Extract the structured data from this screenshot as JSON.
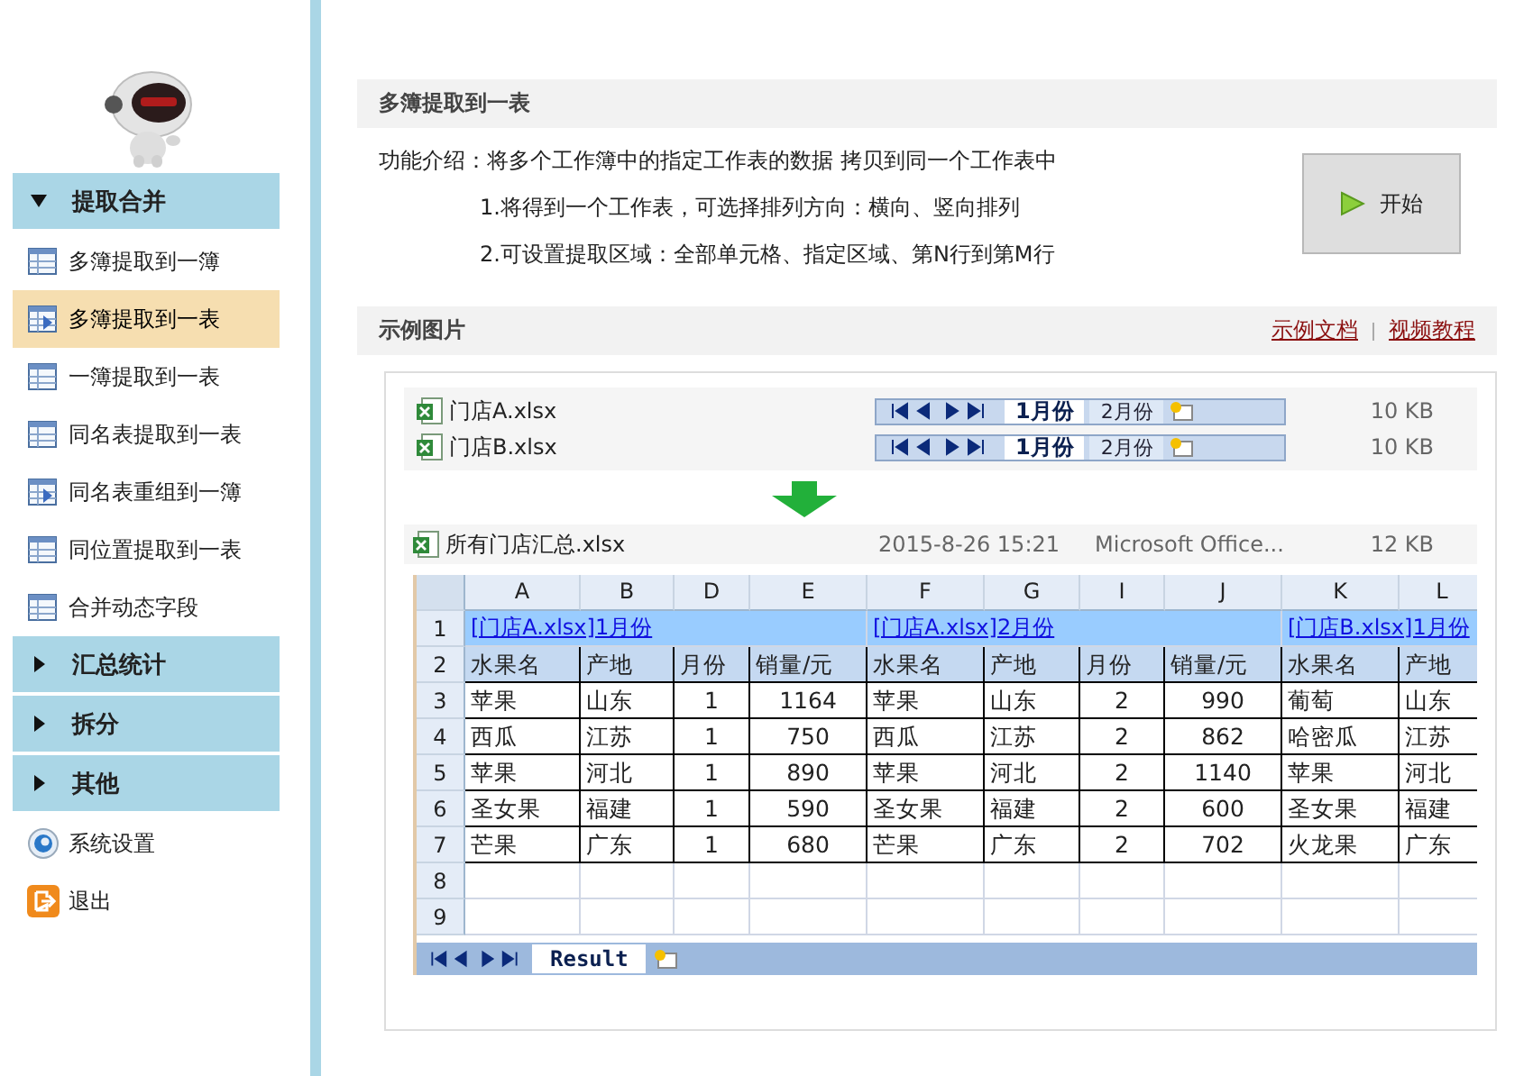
{
  "sidebar": {
    "sections": [
      {
        "title": "提取合并",
        "expanded": true,
        "items": [
          {
            "label": "多簿提取到一簿",
            "selected": false
          },
          {
            "label": "多簿提取到一表",
            "selected": true
          },
          {
            "label": "一簿提取到一表",
            "selected": false
          },
          {
            "label": "同名表提取到一表",
            "selected": false
          },
          {
            "label": "同名表重组到一簿",
            "selected": false
          },
          {
            "label": "同位置提取到一表",
            "selected": false
          },
          {
            "label": "合并动态字段",
            "selected": false
          }
        ]
      },
      {
        "title": "汇总统计",
        "expanded": false
      },
      {
        "title": "拆分",
        "expanded": false
      },
      {
        "title": "其他",
        "expanded": false
      }
    ],
    "footer_items": [
      {
        "label": "系统设置",
        "kind": "settings"
      },
      {
        "label": "退出",
        "kind": "exit"
      }
    ]
  },
  "main": {
    "title": "多簿提取到一表",
    "description": "功能介绍：将多个工作簿中的指定工作表的数据 拷贝到同一个工作表中",
    "points": [
      "1.将得到一个工作表，可选择排列方向：横向、竖向排列",
      "2.可设置提取区域：全部单元格、指定区域、第N行到第M行"
    ],
    "start_button": "开始",
    "example_title": "示例图片",
    "links": [
      "示例文档",
      "视频教程"
    ]
  },
  "example": {
    "source_files": [
      {
        "name": "门店A.xlsx",
        "tabs": [
          {
            "label": "1月份",
            "selected": true
          },
          {
            "label": "2月份",
            "selected": false
          }
        ],
        "size": "10 KB"
      },
      {
        "name": "门店B.xlsx",
        "tabs": [
          {
            "label": "1月份",
            "selected": true
          },
          {
            "label": "2月份",
            "selected": false
          }
        ],
        "size": "10 KB"
      }
    ],
    "result_file": {
      "name": "所有门店汇总.xlsx",
      "date": "2015-8-26 15:21",
      "type": "Microsoft Office...",
      "size": "12 KB"
    },
    "sheet": {
      "columns": [
        {
          "letter": "A",
          "kind": "text"
        },
        {
          "letter": "B",
          "kind": "text"
        },
        {
          "letter": "D",
          "kind": "number"
        },
        {
          "letter": "E",
          "kind": "number"
        },
        {
          "letter": "F",
          "kind": "text"
        },
        {
          "letter": "G",
          "kind": "text"
        },
        {
          "letter": "I",
          "kind": "number"
        },
        {
          "letter": "J",
          "kind": "number"
        },
        {
          "letter": "K",
          "kind": "text"
        },
        {
          "letter": "L",
          "kind": "text"
        }
      ],
      "rows": [
        {
          "number": "1",
          "kind": "title",
          "cells": [
            {
              "text": "[门店A.xlsx]1月份"
            },
            {
              "text": ""
            },
            {
              "text": ""
            },
            {
              "text": ""
            },
            {
              "text": "[门店A.xlsx]2月份"
            },
            {
              "text": ""
            },
            {
              "text": ""
            },
            {
              "text": ""
            },
            {
              "text": "[门店B.xlsx]1月份"
            },
            {
              "text": ""
            }
          ]
        },
        {
          "number": "2",
          "kind": "header",
          "cells": [
            {
              "text": "水果名"
            },
            {
              "text": "产地"
            },
            {
              "text": "月份"
            },
            {
              "text": "销量/元"
            },
            {
              "text": "水果名"
            },
            {
              "text": "产地"
            },
            {
              "text": "月份"
            },
            {
              "text": "销量/元"
            },
            {
              "text": "水果名"
            },
            {
              "text": "产地"
            }
          ]
        },
        {
          "number": "3",
          "kind": "data",
          "cells": [
            {
              "text": "苹果"
            },
            {
              "text": "山东"
            },
            {
              "text": "1"
            },
            {
              "text": "1164"
            },
            {
              "text": "苹果"
            },
            {
              "text": "山东"
            },
            {
              "text": "2"
            },
            {
              "text": "990"
            },
            {
              "text": "葡萄"
            },
            {
              "text": "山东"
            }
          ]
        },
        {
          "number": "4",
          "kind": "data",
          "cells": [
            {
              "text": "西瓜"
            },
            {
              "text": "江苏"
            },
            {
              "text": "1"
            },
            {
              "text": "750"
            },
            {
              "text": "西瓜"
            },
            {
              "text": "江苏"
            },
            {
              "text": "2"
            },
            {
              "text": "862"
            },
            {
              "text": "哈密瓜"
            },
            {
              "text": "江苏"
            }
          ]
        },
        {
          "number": "5",
          "kind": "data",
          "cells": [
            {
              "text": "苹果"
            },
            {
              "text": "河北"
            },
            {
              "text": "1"
            },
            {
              "text": "890"
            },
            {
              "text": "苹果"
            },
            {
              "text": "河北"
            },
            {
              "text": "2"
            },
            {
              "text": "1140"
            },
            {
              "text": "苹果"
            },
            {
              "text": "河北"
            }
          ]
        },
        {
          "number": "6",
          "kind": "data",
          "cells": [
            {
              "text": "圣女果"
            },
            {
              "text": "福建"
            },
            {
              "text": "1"
            },
            {
              "text": "590"
            },
            {
              "text": "圣女果"
            },
            {
              "text": "福建"
            },
            {
              "text": "2"
            },
            {
              "text": "600"
            },
            {
              "text": "圣女果"
            },
            {
              "text": "福建"
            }
          ]
        },
        {
          "number": "7",
          "kind": "data",
          "cells": [
            {
              "text": "芒果"
            },
            {
              "text": "广东"
            },
            {
              "text": "1"
            },
            {
              "text": "680"
            },
            {
              "text": "芒果"
            },
            {
              "text": "广东"
            },
            {
              "text": "2"
            },
            {
              "text": "702"
            },
            {
              "text": "火龙果"
            },
            {
              "text": "广东"
            }
          ]
        },
        {
          "number": "8",
          "kind": "empty"
        },
        {
          "number": "9",
          "kind": "empty"
        }
      ],
      "tabs": [
        {
          "label": "Result",
          "selected": true
        }
      ]
    }
  }
}
